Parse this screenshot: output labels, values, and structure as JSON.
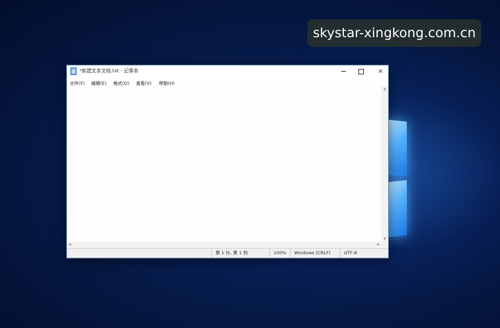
{
  "watermark": {
    "text": "skystar-xingkong.com.cn"
  },
  "window": {
    "title": "*新建文本文档.txt - 记事本",
    "app_icon": "notepad-icon",
    "controls": {
      "minimize": "minimize-icon",
      "maximize": "maximize-icon",
      "close": "×"
    }
  },
  "menu": [
    {
      "label": "文件(F)"
    },
    {
      "label": "编辑(E)"
    },
    {
      "label": "格式(O)"
    },
    {
      "label": "查看(V)"
    },
    {
      "label": "帮助(H)"
    }
  ],
  "editor": {
    "content": ""
  },
  "scrollbars": {
    "up": "▲",
    "down": "▼",
    "left": "◀",
    "right": "▶"
  },
  "status": {
    "position": "第 1 行, 第 1 列",
    "zoom": "100%",
    "line_ending": "Windows (CRLF)",
    "encoding": "UTF-8"
  },
  "colors": {
    "desktop": "#061a48",
    "window_border": "#6b8fb5",
    "logo": "#53b2ff"
  }
}
